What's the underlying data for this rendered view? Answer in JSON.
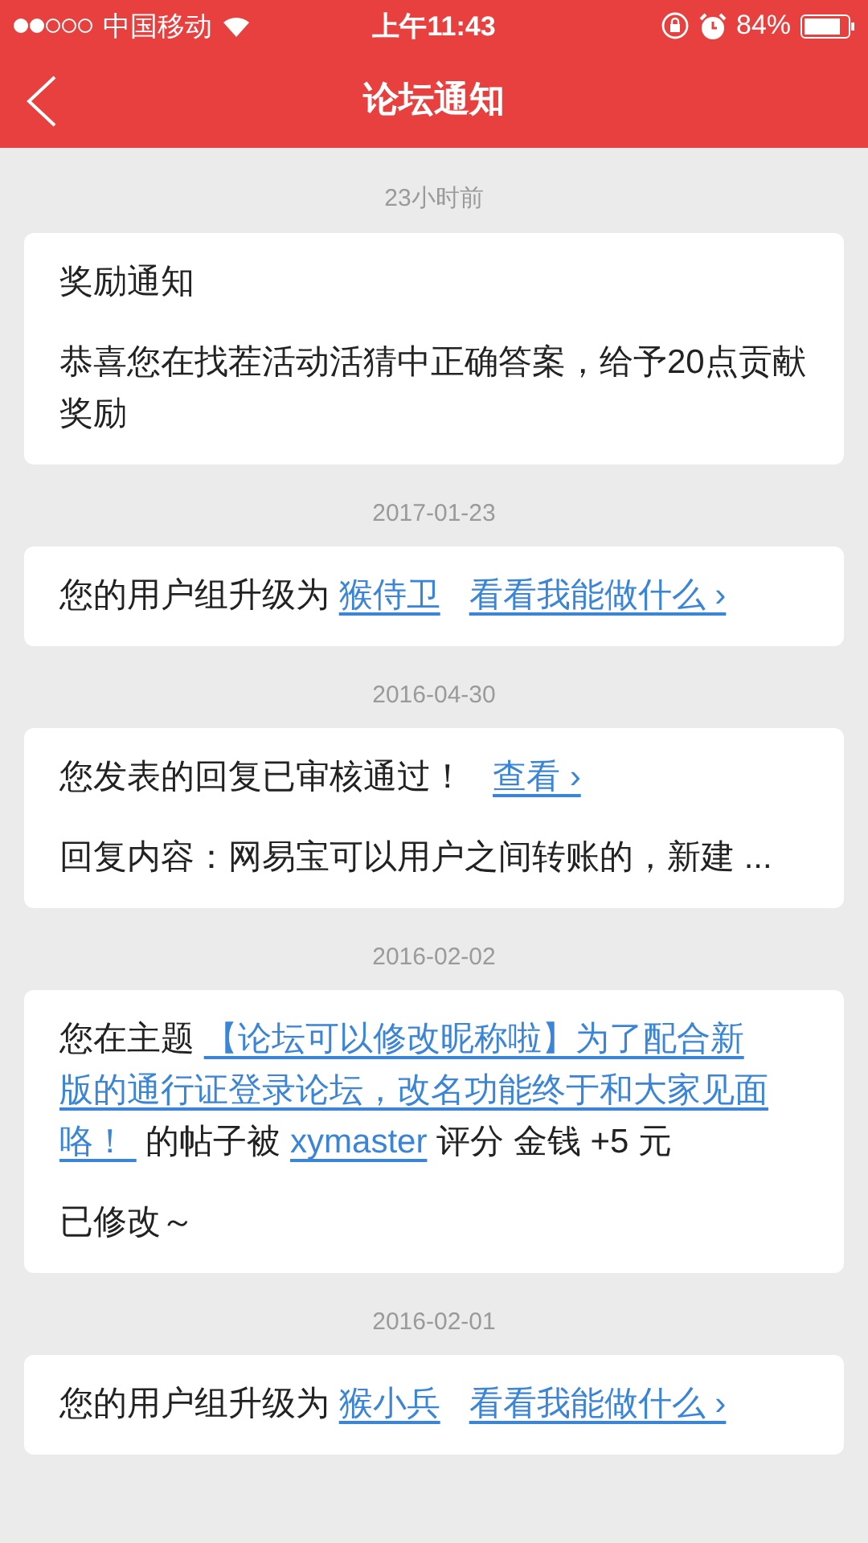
{
  "status_bar": {
    "carrier": "中国移动",
    "time": "上午11:43",
    "battery": "84%"
  },
  "nav": {
    "title": "论坛通知"
  },
  "notices": [
    {
      "time": "23小时前",
      "paragraphs": [
        [
          {
            "kind": "text",
            "text": "奖励通知"
          }
        ],
        [
          {
            "kind": "text",
            "text": "恭喜您在找茬活动活猜中正确答案，给予20点贡献奖励"
          }
        ]
      ]
    },
    {
      "time": "2017-01-23",
      "paragraphs": [
        [
          {
            "kind": "text",
            "text": "您的用户组升级为 "
          },
          {
            "kind": "link",
            "text": "猴侍卫"
          },
          {
            "kind": "link",
            "text": "看看我能做什么 ›"
          }
        ]
      ]
    },
    {
      "time": "2016-04-30",
      "paragraphs": [
        [
          {
            "kind": "text",
            "text": "您发表的回复已审核通过！   "
          },
          {
            "kind": "link",
            "text": "查看 ›"
          }
        ],
        [
          {
            "kind": "text",
            "text": "回复内容：网易宝可以用户之间转账的，新建 ..."
          }
        ]
      ]
    },
    {
      "time": "2016-02-02",
      "paragraphs": [
        [
          {
            "kind": "text",
            "text": "您在主题 "
          },
          {
            "kind": "link",
            "text": "【论坛可以修改昵称啦】为了配合新"
          },
          {
            "kind": "link",
            "text": "版的通行证登录论坛，改名功能终于和大家见面"
          },
          {
            "kind": "link",
            "text": "咯！ "
          },
          {
            "kind": "text",
            "text": " 的帖子被 "
          },
          {
            "kind": "link",
            "text": "xymaster"
          },
          {
            "kind": "text",
            "text": " 评分 金钱 +5 元"
          }
        ],
        [
          {
            "kind": "text",
            "text": "已修改～"
          }
        ]
      ]
    },
    {
      "time": "2016-02-01",
      "paragraphs": [
        [
          {
            "kind": "text",
            "text": "您的用户组升级为 "
          },
          {
            "kind": "link",
            "text": "猴小兵"
          },
          {
            "kind": "link",
            "text": "看看我能做什么 ›"
          }
        ]
      ]
    }
  ]
}
